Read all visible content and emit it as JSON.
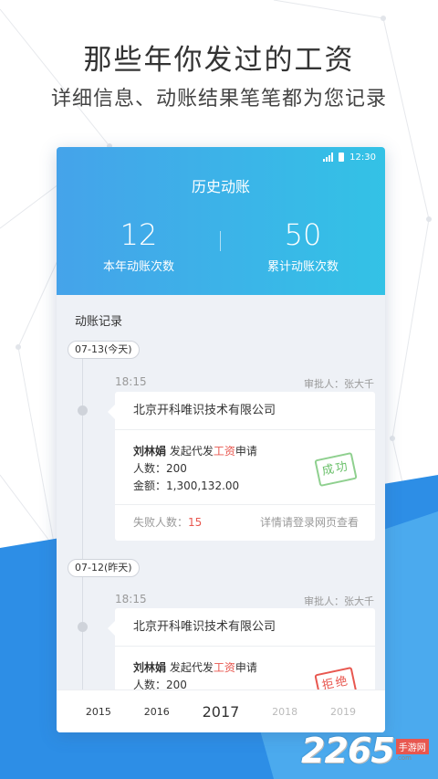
{
  "promo": {
    "title": "那些年你发过的工资",
    "subtitle": "详细信息、动账结果笔笔都为您记录"
  },
  "status_bar": {
    "time": "12:30",
    "signal_icon": "signal-icon",
    "battery_icon": "battery-icon"
  },
  "header": {
    "title": "历史动账",
    "stats": [
      {
        "value": "12",
        "label": "本年动账次数"
      },
      {
        "value": "50",
        "label": "累计动账次数"
      }
    ]
  },
  "section_title": "动账记录",
  "records": [
    {
      "date": "07-13(今天)",
      "time": "18:15",
      "approver": "审批人：张大千",
      "company": "北京开科唯识技术有限公司",
      "person": "刘林娟",
      "action_prefix": "发起代发",
      "action_accent": "工资",
      "action_suffix": "申请",
      "count_line": "人数：200",
      "amount_line": "金额：1,300,132.00",
      "stamp": "成功",
      "fail_label": "失败人数：",
      "fail_count": "15",
      "detail_hint": "详情请登录网页查看"
    },
    {
      "date": "07-12(昨天)",
      "time": "18:15",
      "approver": "审批人：张大千",
      "company": "北京开科唯识技术有限公司",
      "person": "刘林娟",
      "action_prefix": "发起代发",
      "action_accent": "工资",
      "action_suffix": "申请",
      "count_line": "人数：200",
      "stamp": "拒绝"
    }
  ],
  "years": [
    "2015",
    "2016",
    "2017",
    "2018",
    "2019"
  ],
  "selected_year": "2017",
  "watermark": {
    "number": "2265",
    "suffix_top": "手游网",
    "suffix_bottom": ".com"
  },
  "colors": {
    "header_start": "#45a3ea",
    "header_end": "#33c2e6",
    "accent_red": "#e8574f",
    "success_green": "#6cc16c",
    "wedge_blue": "#2d8ee6"
  }
}
